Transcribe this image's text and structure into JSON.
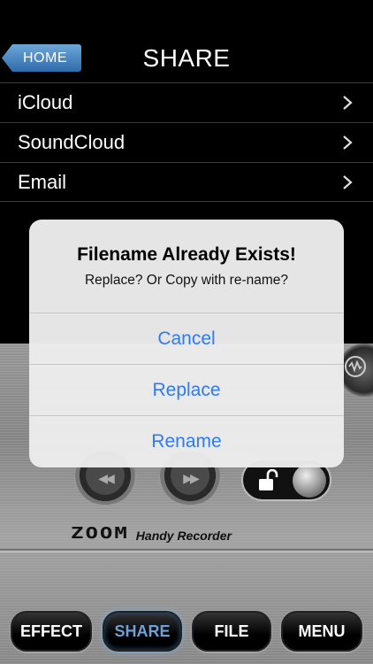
{
  "header": {
    "home_label": "HOME",
    "title": "SHARE"
  },
  "share_list": [
    {
      "label": "iCloud"
    },
    {
      "label": "SoundCloud"
    },
    {
      "label": "Email"
    }
  ],
  "device": {
    "brand_logo": "ZOOM",
    "brand_sub": "Handy Recorder",
    "prev_glyph": "◀◀",
    "next_glyph": "▶▶"
  },
  "tabs": [
    {
      "label": "EFFECT"
    },
    {
      "label": "SHARE",
      "active": true
    },
    {
      "label": "FILE"
    },
    {
      "label": "MENU"
    }
  ],
  "alert": {
    "title": "Filename Already Exists!",
    "message": "Replace? Or Copy with re-name?",
    "buttons": {
      "cancel": "Cancel",
      "replace": "Replace",
      "rename": "Rename"
    }
  },
  "colors": {
    "accent_blue": "#2f7bf0",
    "home_blue": "#4a86c4",
    "status_red": "#e8202a"
  }
}
